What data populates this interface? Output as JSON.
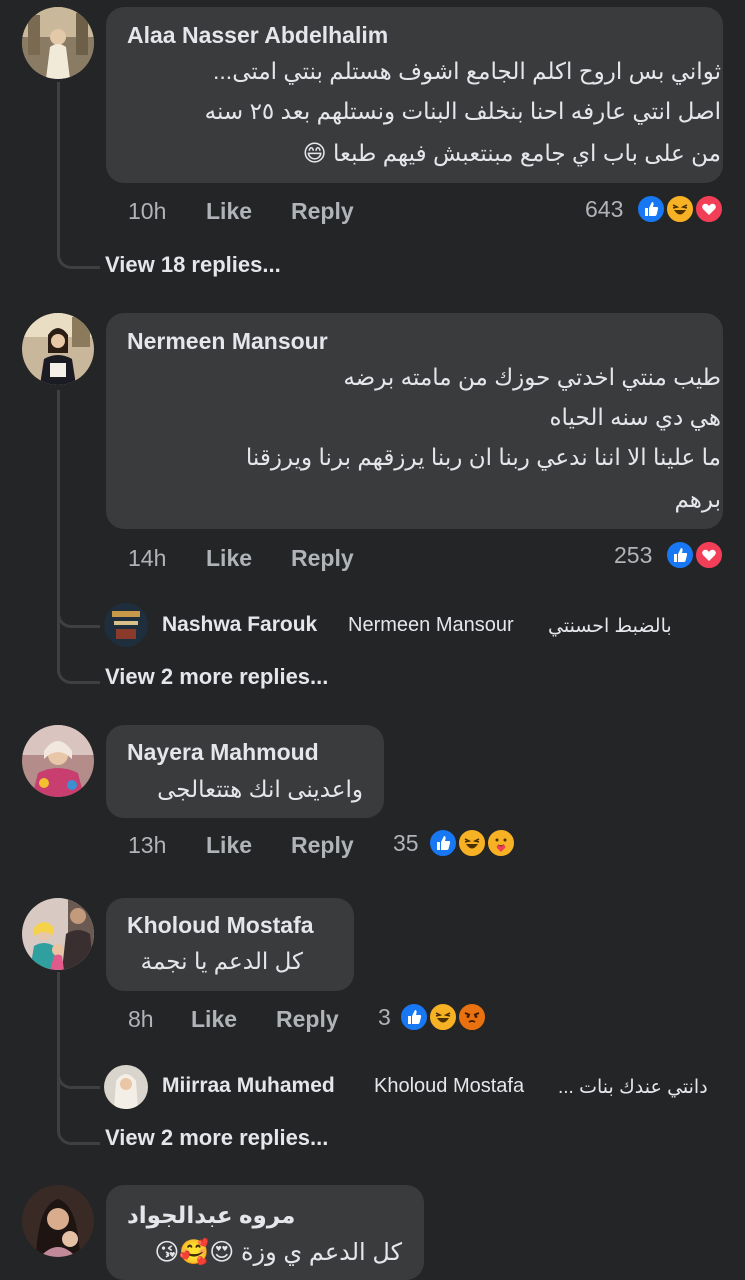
{
  "comments": [
    {
      "author": "Alaa Nasser Abdelhalim",
      "lines": [
        "ثواني بس اروح اكلم الجامع اشوف هستلم بنتي امتى...",
        "اصل انتي عارفه احنا بنخلف البنات ونستلهم بعد ٢٥ سنه",
        "من على باب اي جامع مبنتعبش فيهم طبعا 😄"
      ],
      "time": "10h",
      "like": "Like",
      "reply": "Reply",
      "reaction_count": "643",
      "reactions": [
        "like-icon",
        "haha-icon",
        "love-icon"
      ],
      "view_replies": "View 18 replies..."
    },
    {
      "author": "Nermeen Mansour",
      "lines": [
        "طيب منتي اخدتي حوزك من مامته برضه",
        "هي دي سنه الحياه",
        "ما علينا الا اننا ندعي ربنا ان ربنا يرزقهم برنا ويرزقنا",
        "برهم"
      ],
      "time": "14h",
      "like": "Like",
      "reply": "Reply",
      "reaction_count": "253",
      "reactions": [
        "like-icon",
        "love-icon"
      ],
      "reply_preview": {
        "author": "Nashwa Farouk",
        "tag": "Nermeen Mansour",
        "text": "بالضبط احسنتي"
      },
      "view_replies": "View 2 more replies..."
    },
    {
      "author": "Nayera Mahmoud",
      "lines": [
        "واعدينى انك هتتعالجى"
      ],
      "time": "13h",
      "like": "Like",
      "reply": "Reply",
      "reaction_count": "35",
      "reactions": [
        "like-icon",
        "haha-icon",
        "care-icon"
      ]
    },
    {
      "author": "Kholoud Mostafa",
      "lines": [
        "كل الدعم يا نجمة"
      ],
      "time": "8h",
      "like": "Like",
      "reply": "Reply",
      "reaction_count": "3",
      "reactions": [
        "like-icon",
        "haha-icon",
        "angry-icon"
      ],
      "reply_preview": {
        "author": "Miirraa Muhamed",
        "tag": "Kholoud Mostafa",
        "text": "دانتي عندك بنات ..."
      },
      "view_replies": "View 2 more replies..."
    },
    {
      "author": "مروه عبدالجواد",
      "lines": [
        "كل الدعم ي وزة 😍🥰😘"
      ]
    }
  ],
  "colors": {
    "background": "#242526",
    "bubble": "#3a3b3c",
    "like_blue": "#1877f2",
    "love_red": "#f33e58",
    "haha_yellow": "#f7b125"
  }
}
